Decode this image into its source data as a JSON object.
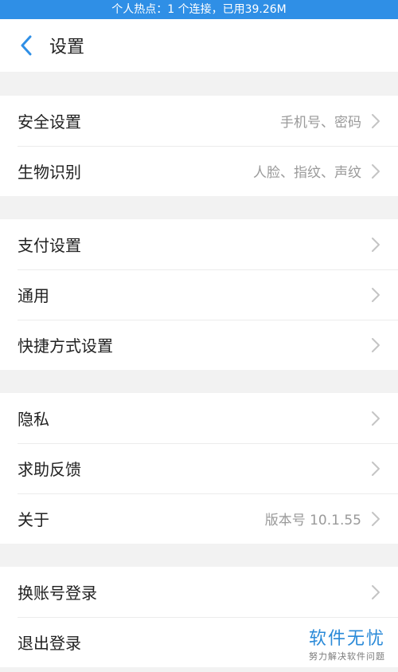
{
  "status_bar": {
    "text": "个人热点：1 个连接，已用39.26M"
  },
  "header": {
    "title": "设置"
  },
  "groups": [
    {
      "items": [
        {
          "label": "安全设置",
          "value": "手机号、密码"
        },
        {
          "label": "生物识别",
          "value": "人脸、指纹、声纹"
        }
      ]
    },
    {
      "items": [
        {
          "label": "支付设置",
          "value": ""
        },
        {
          "label": "通用",
          "value": ""
        },
        {
          "label": "快捷方式设置",
          "value": ""
        }
      ]
    },
    {
      "items": [
        {
          "label": "隐私",
          "value": ""
        },
        {
          "label": "求助反馈",
          "value": ""
        },
        {
          "label": "关于",
          "value": "版本号 10.1.55"
        }
      ]
    },
    {
      "items": [
        {
          "label": "换账号登录",
          "value": ""
        },
        {
          "label": "退出登录",
          "value": ""
        }
      ]
    }
  ],
  "watermark": {
    "main": "软件无忧",
    "sub": "努力解决软件问题"
  },
  "colors": {
    "accent": "#2f8fe6",
    "background": "#f2f2f2",
    "secondary_text": "#9a9a9a"
  },
  "icons": {
    "back": "chevron-left-icon",
    "row_arrow": "chevron-right-icon"
  }
}
